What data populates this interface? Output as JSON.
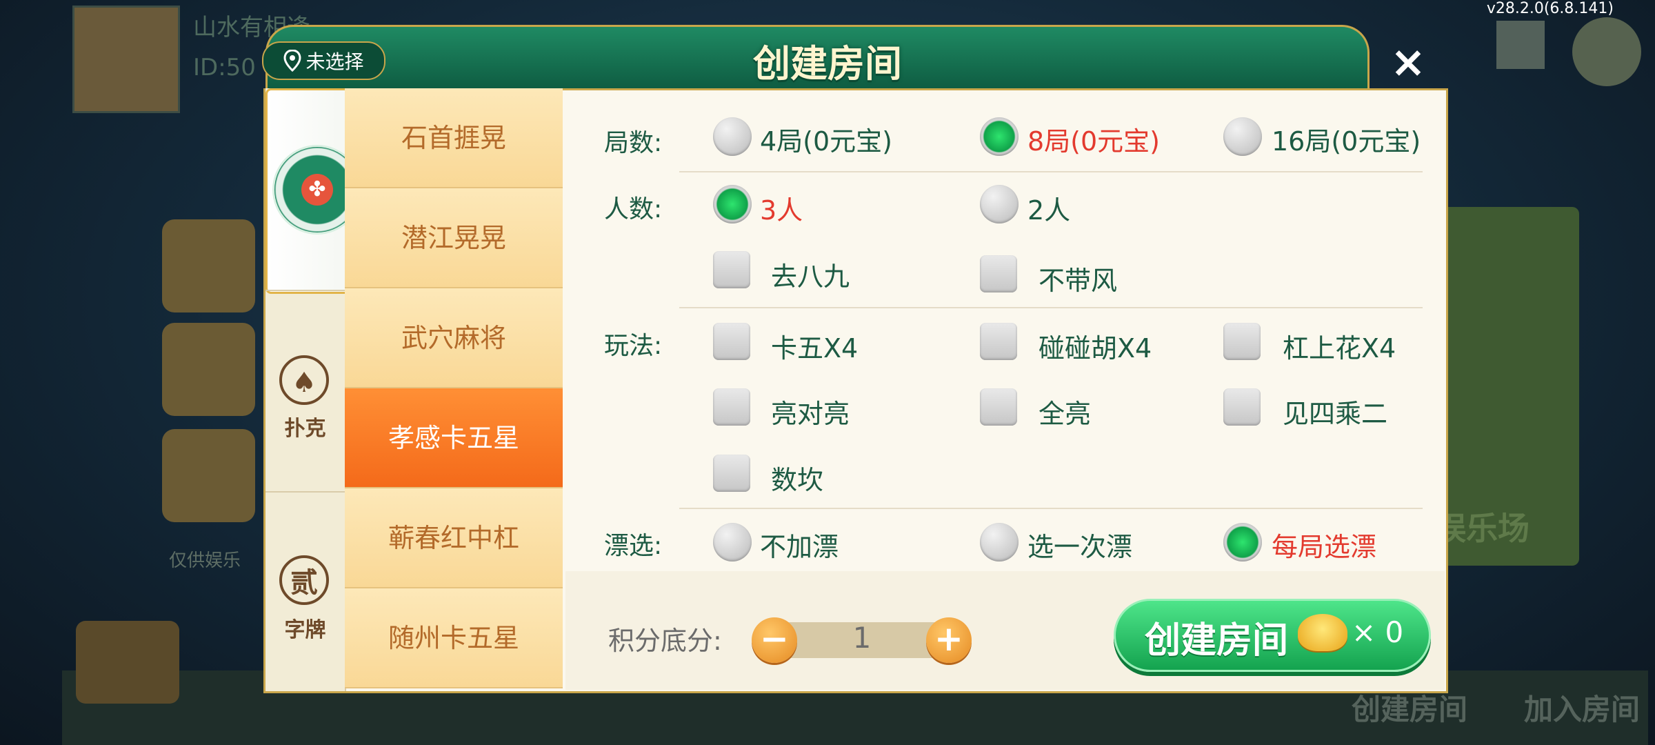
{
  "background": {
    "player_name": "山水有相逢",
    "player_id": "ID:50",
    "version": "v28.2.0(6.8.141)",
    "note": "仅供娱乐",
    "right_panel_text": "娱乐场",
    "bottom_create": "创建房间",
    "bottom_join": "加入房间"
  },
  "dialog": {
    "title": "创建房间",
    "location": "未选择",
    "close_icon": "×",
    "categories": [
      {
        "label": "",
        "icon": "mahjong-icon",
        "selected": true
      },
      {
        "label": "扑克",
        "icon_glyph": "♠",
        "selected": false
      },
      {
        "label": "字牌",
        "icon_glyph": "贰",
        "selected": false
      }
    ],
    "games": [
      "石首捱晃",
      "潜江晃晃",
      "武穴麻将",
      "孝感卡五星",
      "蕲春红中杠",
      "随州卡五星"
    ],
    "active_game": "孝感卡五星",
    "rows": {
      "rounds": {
        "label": "局数:",
        "options": [
          "4局(0元宝)",
          "8局(0元宝)",
          "16局(0元宝)"
        ],
        "selected": "8局(0元宝)"
      },
      "players": {
        "label": "人数:",
        "options": [
          "3人",
          "2人"
        ],
        "selected": "3人",
        "extra": [
          "去八九",
          "不带风"
        ]
      },
      "rules": {
        "label": "玩法:",
        "options": [
          "卡五X4",
          "碰碰胡X4",
          "杠上花X4",
          "亮对亮",
          "全亮",
          "见四乘二",
          "数坎"
        ]
      },
      "float": {
        "label": "漂选:",
        "options": [
          "不加漂",
          "选一次漂",
          "每局选漂"
        ],
        "selected": "每局选漂"
      }
    },
    "score": {
      "label": "积分底分:",
      "value": "1",
      "minus": "−",
      "plus": "+"
    },
    "create": {
      "label": "创建房间",
      "cost": "× 0"
    }
  },
  "colors": {
    "accent_green": "#14a34f",
    "selected_text": "#e33a2e",
    "active_tab": "#f46a1a",
    "label_green": "#1d5a43"
  }
}
